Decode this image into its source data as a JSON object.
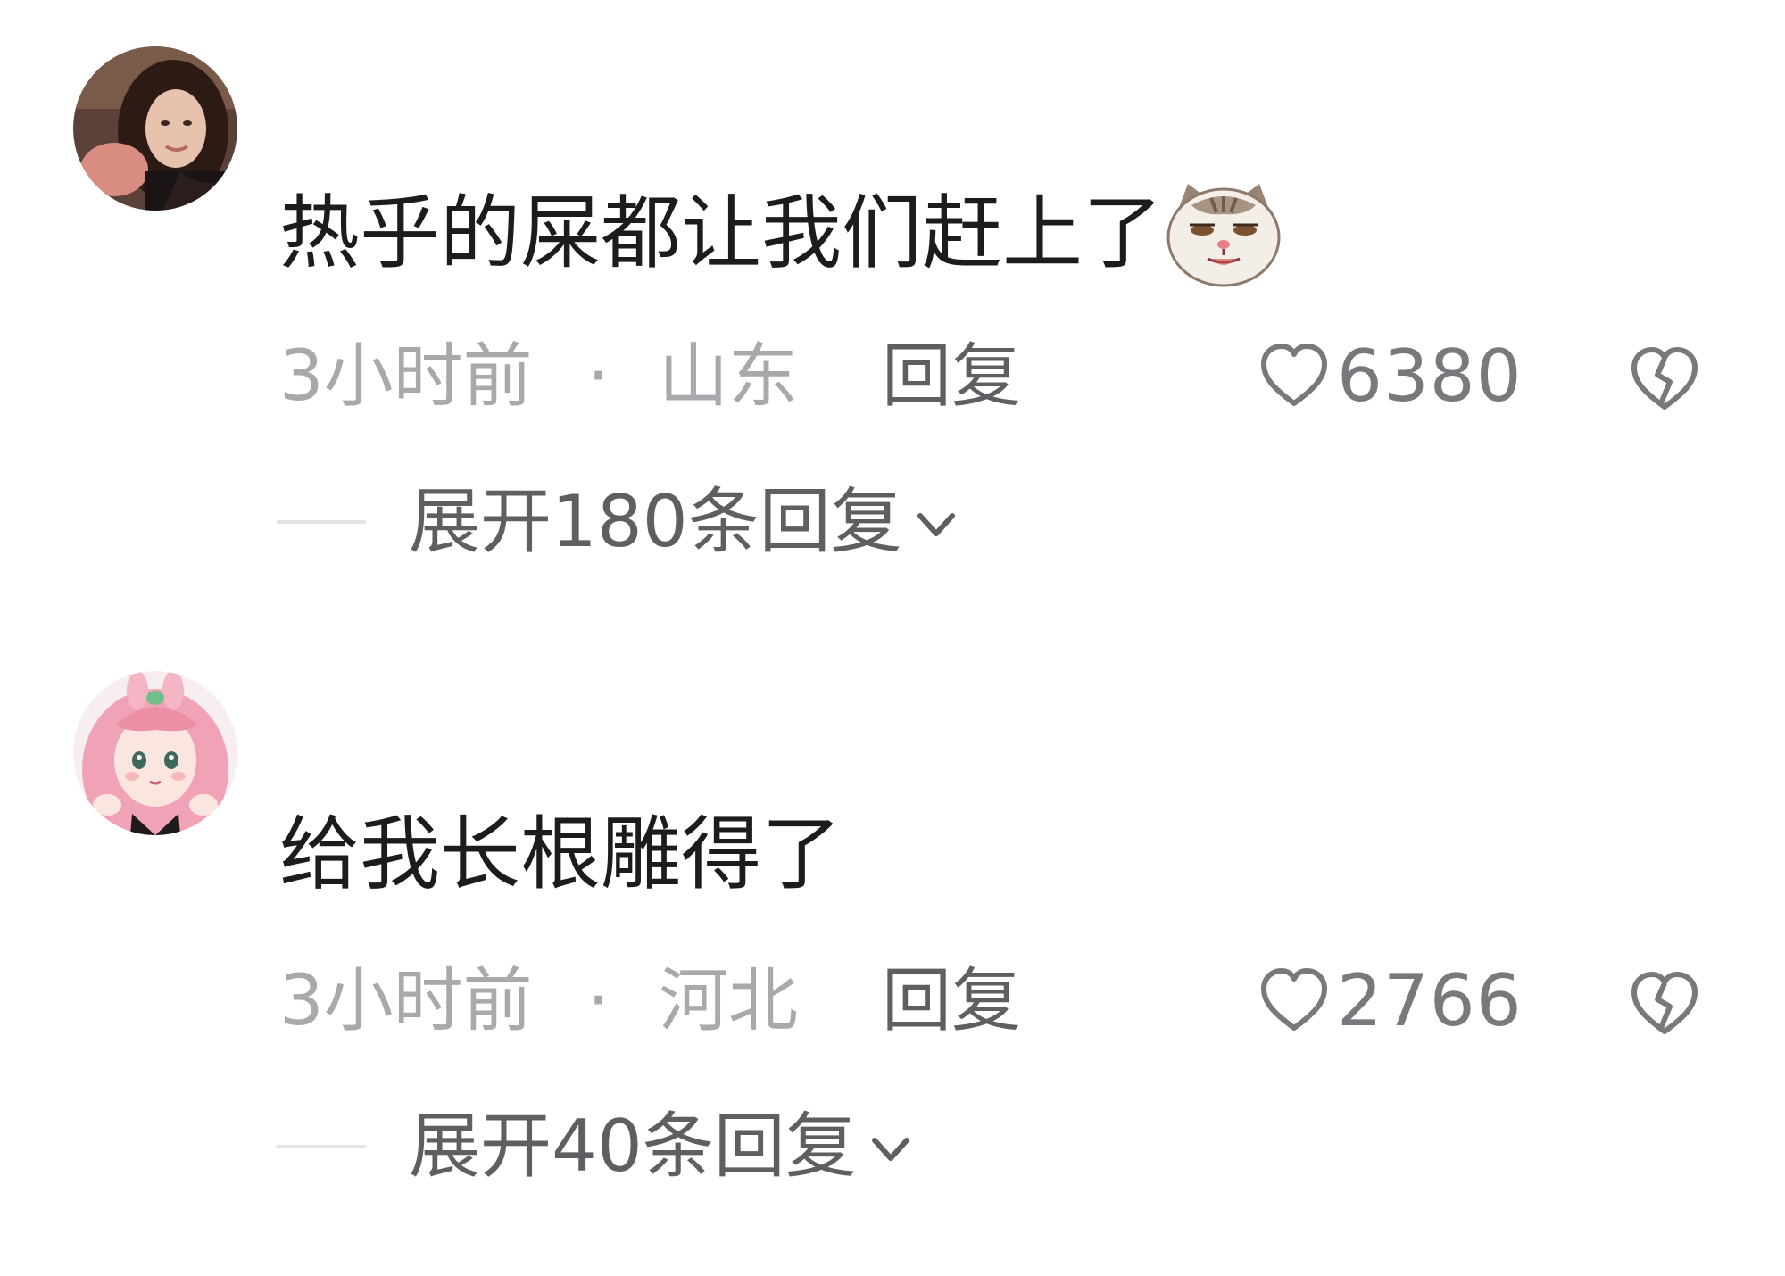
{
  "comments": [
    {
      "avatar": "photo-avatar-woman",
      "text": "热乎的屎都让我们赶上了",
      "emoji": "cat-face-emoji",
      "time": "3小时前",
      "separator": "·",
      "location": "山东",
      "reply_label": "回复",
      "like_count": "6380",
      "expand_label": "展开180条回复"
    },
    {
      "avatar": "cartoon-avatar-pink-hair",
      "text": "给我长根雕得了",
      "time": "3小时前",
      "separator": "·",
      "location": "河北",
      "reply_label": "回复",
      "like_count": "2766",
      "expand_label": "展开40条回复"
    }
  ],
  "colors": {
    "text_primary": "#1c1c1e",
    "text_muted": "#a8a8ad",
    "text_secondary": "#5f5f63",
    "icon": "#78787d"
  }
}
